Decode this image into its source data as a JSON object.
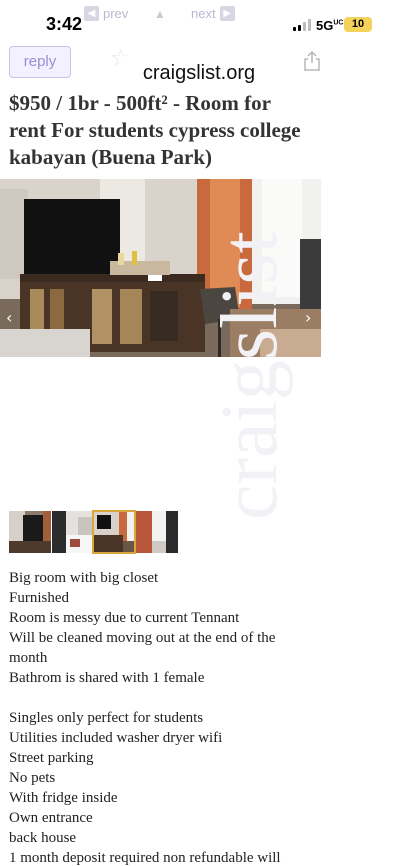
{
  "status_bar": {
    "time": "3:42",
    "network": "5G",
    "battery": "10"
  },
  "nav": {
    "prev_label": "prev",
    "next_label": "next",
    "prev_icon": "chevron-left-icon",
    "up_icon": "triangle-up-icon",
    "next_icon": "chevron-right-icon"
  },
  "header": {
    "reply_label": "reply",
    "url": "craigslist.org",
    "favorite_icon": "star-icon",
    "share_icon": "share-icon"
  },
  "posting": {
    "title": "$950 / 1br - 500ft² - Room for rent For students cypress college kabayan (Buena Park)",
    "image": {
      "prev_arrow": "‹",
      "next_arrow": "›",
      "thumbnail_count": 4,
      "selected_thumbnail": 3
    },
    "watermark": "craigslist",
    "description": [
      "Big room with big closet",
      "Furnished",
      "Room is messy due to current Tennant",
      "Will be cleaned moving out at the end of the",
      "month",
      "Bathrom is shared with 1 female",
      "",
      "Singles only perfect for students",
      "Utilities included washer dryer wifi",
      "Street parking",
      "No pets",
      "With fridge inside",
      "Own entrance",
      "back house",
      "1 month deposit required non refundable will"
    ]
  },
  "colors": {
    "reply_bg": "#f3f0ff",
    "reply_text": "#9a8ed0",
    "nav_text": "#b9b9ce",
    "battery": "#f3d35a",
    "thumb_selected_border": "#d9a83a"
  }
}
